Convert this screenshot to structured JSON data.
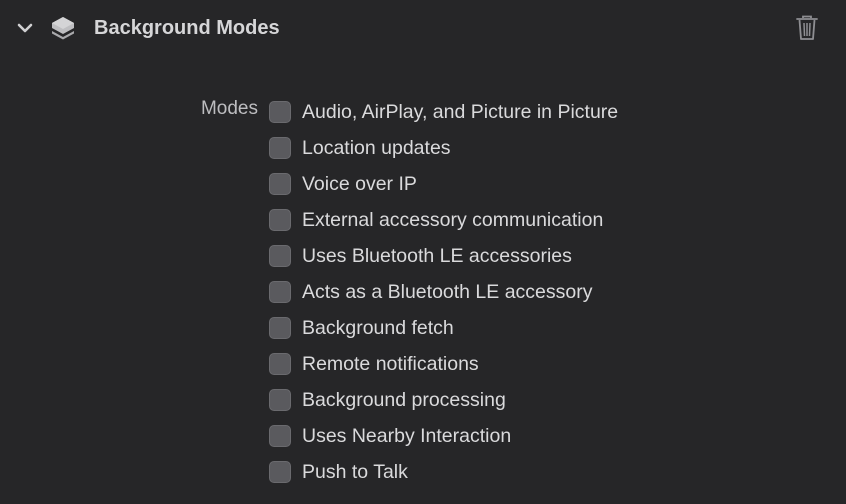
{
  "section": {
    "title": "Background Modes",
    "expanded": true,
    "icons": {
      "disclosure": "chevron-down-icon",
      "capability": "background-modes-stack-icon",
      "delete": "trash-icon"
    }
  },
  "modes": {
    "label": "Modes",
    "items": [
      {
        "label": "Audio, AirPlay, and Picture in Picture",
        "checked": false
      },
      {
        "label": "Location updates",
        "checked": false
      },
      {
        "label": "Voice over IP",
        "checked": false
      },
      {
        "label": "External accessory communication",
        "checked": false
      },
      {
        "label": "Uses Bluetooth LE accessories",
        "checked": false
      },
      {
        "label": "Acts as a Bluetooth LE accessory",
        "checked": false
      },
      {
        "label": "Background fetch",
        "checked": false
      },
      {
        "label": "Remote notifications",
        "checked": false
      },
      {
        "label": "Background processing",
        "checked": false
      },
      {
        "label": "Uses Nearby Interaction",
        "checked": false
      },
      {
        "label": "Push to Talk",
        "checked": false
      }
    ]
  },
  "colors": {
    "background": "#262628",
    "text": "#dadadc",
    "checkbox_off": "#5a5a5e"
  }
}
